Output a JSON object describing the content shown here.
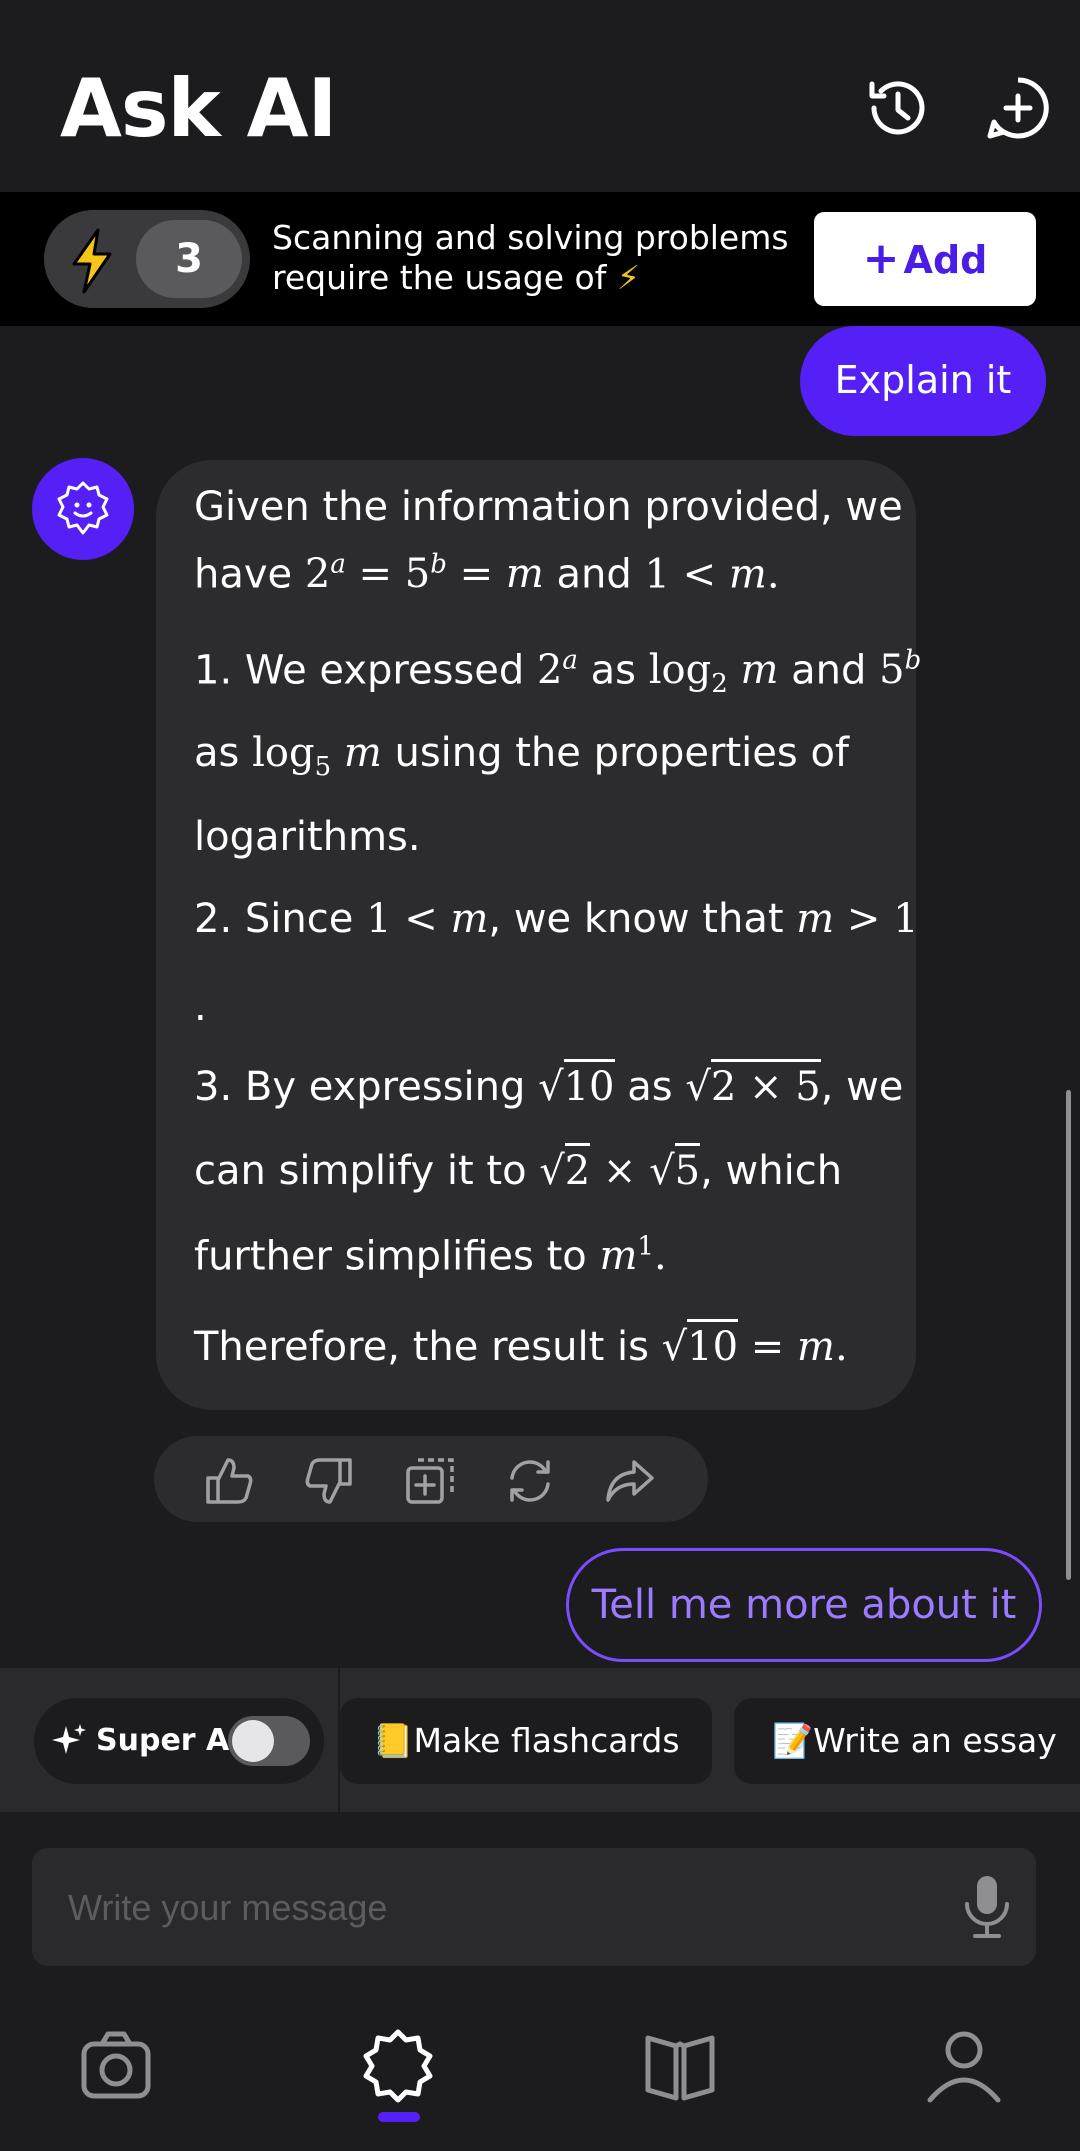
{
  "header": {
    "title": "Ask AI",
    "icons": [
      "history-icon",
      "new-chat-icon"
    ]
  },
  "credits": {
    "count": "3",
    "text_line1": "Scanning and solving problems",
    "text_line2": "require the usage of",
    "add_label": "Add",
    "accent": "#4a1de6",
    "bolt_color": "#f5c518"
  },
  "chat": {
    "user_message_1": "Explain it",
    "bot": {
      "intro_a": "Given the information provided, we",
      "intro_b": "have",
      "intro_and": "and",
      "step1_a": "1. We expressed",
      "step1_as": "as",
      "step1_and": "and",
      "step1_b": "as",
      "step1_c": "using the properties of",
      "step1_d": "logarithms.",
      "step2_a": "2. Since",
      "step2_b": ", we know that",
      "step3_a": "3. By expressing",
      "step3_as": "as",
      "step3_we": ", we",
      "step3_b": "can simplify it to",
      "step3_which": ", which",
      "step3_c": "further simplifies to",
      "conclusion": "Therefore, the result is"
    },
    "user_message_2": "Tell me more about it"
  },
  "actions": [
    "thumbs-up-icon",
    "thumbs-down-icon",
    "add-to-notes-icon",
    "regenerate-icon",
    "share-icon"
  ],
  "suggestions": {
    "super_ai_label": "Super AI",
    "super_ai_enabled": false,
    "flashcards_label": "📒Make flashcards",
    "essay_label": "📝Write an essay"
  },
  "composer": {
    "placeholder": "Write your message"
  },
  "bottom_nav": {
    "items": [
      "camera-icon",
      "ask-ai-icon",
      "library-icon",
      "profile-icon"
    ],
    "active_index": 1,
    "active_color": "#5420f5"
  }
}
